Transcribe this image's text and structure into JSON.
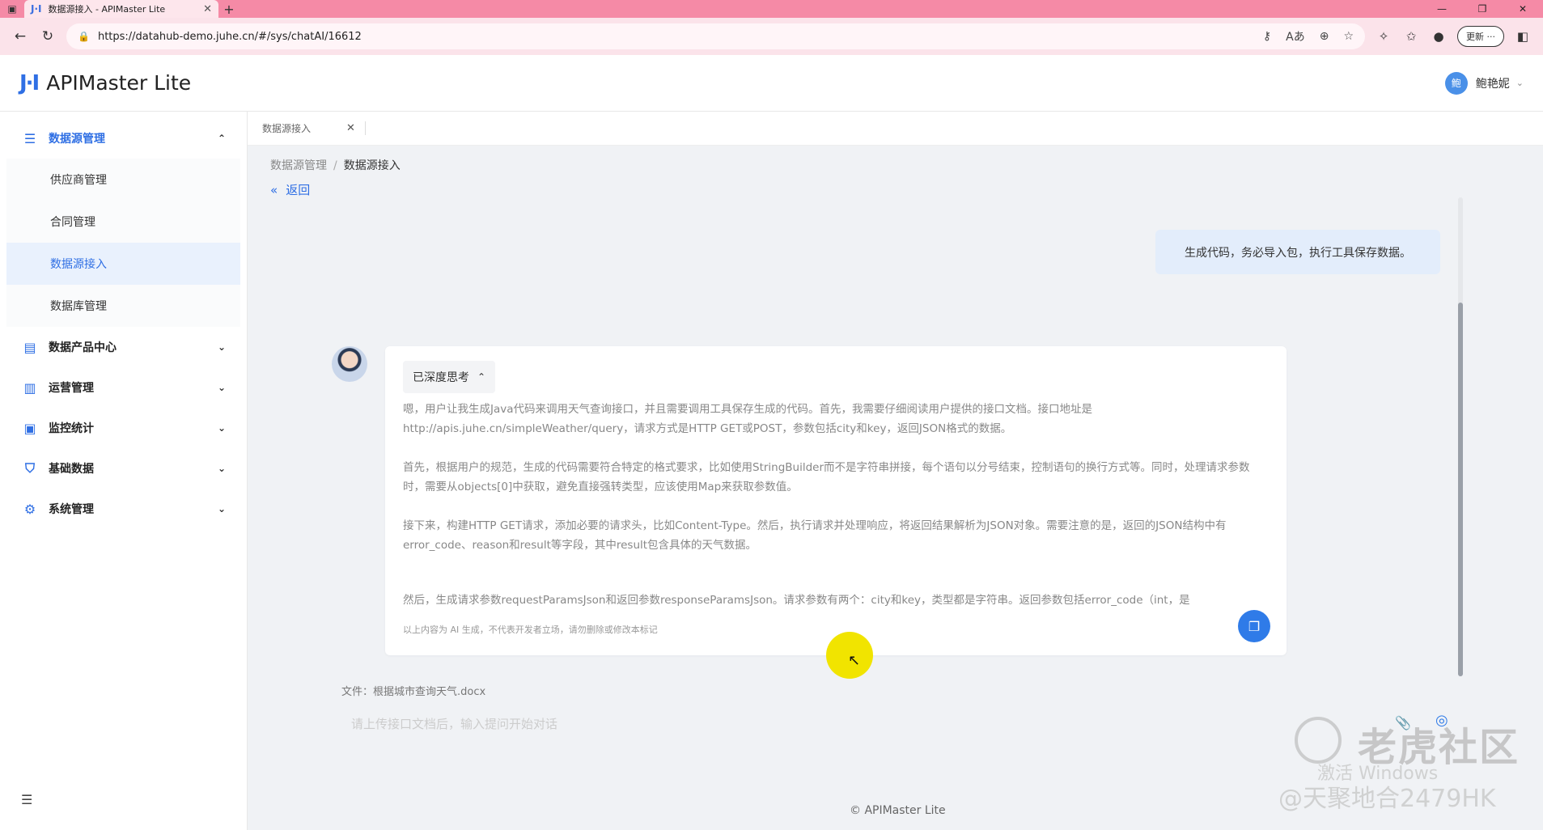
{
  "browser": {
    "tab_title": "数据源接入 - APIMaster Lite",
    "url": "https://datahub-demo.juhe.cn/#/sys/chatAI/16612",
    "update_label": "更新"
  },
  "header": {
    "logo": "J·I",
    "app_title": "APIMaster Lite",
    "user_initial": "鲍",
    "user_name": "鲍艳妮"
  },
  "sidebar": {
    "groups": [
      {
        "label": "数据源管理"
      },
      {
        "label": "数据产品中心"
      },
      {
        "label": "运营管理"
      },
      {
        "label": "监控统计"
      },
      {
        "label": "基础数据"
      },
      {
        "label": "系统管理"
      }
    ],
    "sub_items": [
      {
        "label": "供应商管理"
      },
      {
        "label": "合同管理"
      },
      {
        "label": "数据源接入"
      },
      {
        "label": "数据库管理"
      }
    ]
  },
  "content_tabs": [
    {
      "label": "数据源接入"
    }
  ],
  "breadcrumb": {
    "parent": "数据源管理",
    "sep": "/",
    "current": "数据源接入"
  },
  "back_label": "返回",
  "chat": {
    "user_message": "生成代码，务必导入包，执行工具保存数据。",
    "think_label": "已深度思考",
    "paragraphs": [
      "嗯，用户让我生成Java代码来调用天气查询接口，并且需要调用工具保存生成的代码。首先，我需要仔细阅读用户提供的接口文档。接口地址是http://apis.juhe.cn/simpleWeather/query，请求方式是HTTP GET或POST，参数包括city和key，返回JSON格式的数据。",
      "首先，根据用户的规范，生成的代码需要符合特定的格式要求，比如使用StringBuilder而不是字符串拼接，每个语句以分号结束，控制语句的换行方式等。同时，处理请求参数时，需要从objects[0]中获取，避免直接强转类型，应该使用Map来获取参数值。",
      "接下来，构建HTTP GET请求，添加必要的请求头，比如Content-Type。然后，执行请求并处理响应，将返回结果解析为JSON对象。需要注意的是，返回的JSON结构中有error_code、reason和result等字段，其中result包含具体的天气数据。",
      "然后，生成请求参数requestParamsJson和返回参数responseParamsJson。请求参数有两个：city和key，类型都是字符串。返回参数包括error_code（int，是"
    ],
    "disclaimer": "以上内容为 AI 生成，不代表开发者立场，请勿删除或修改本标记",
    "file_line": "文件：根据城市查询天气.docx",
    "input_placeholder": "请上传接口文档后，输入提问开始对话"
  },
  "footer": "© APIMaster Lite",
  "watermark": {
    "brand": "老虎社区",
    "activate": "激活 Windows",
    "handle": "@天聚地合2479HK"
  },
  "colors": {
    "accent": "#2f6fe4",
    "browser_tab": "#f58aa6"
  }
}
